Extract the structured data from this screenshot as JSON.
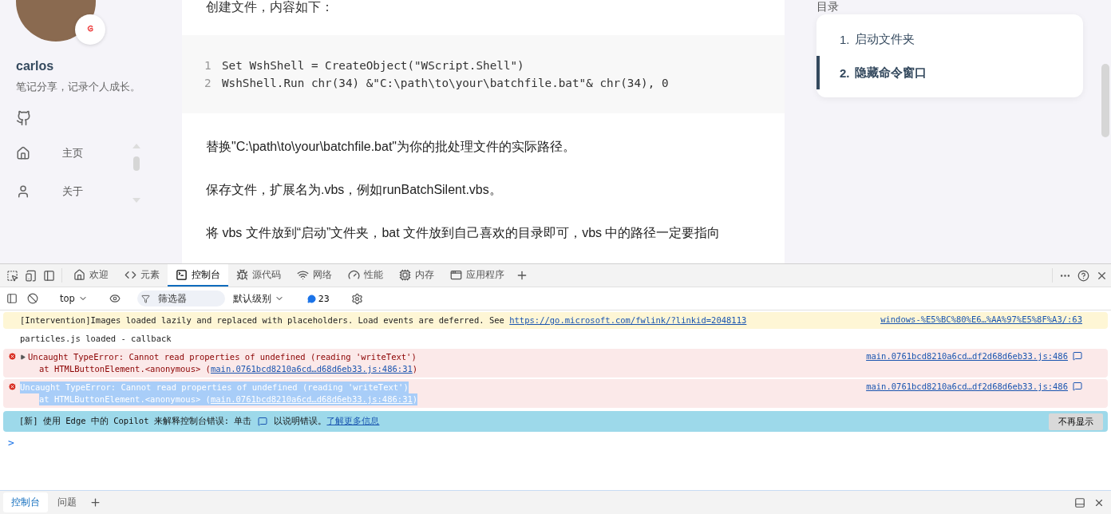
{
  "sidebar": {
    "name": "carlos",
    "bio": "笔记分享，记录个人成长。",
    "nav": [
      {
        "kind": "home",
        "label": "主页"
      },
      {
        "kind": "user",
        "label": "关于"
      }
    ]
  },
  "article": {
    "intro": "创建文件，内容如下：",
    "code": [
      {
        "number": "1",
        "text": "Set WshShell = CreateObject(\"WScript.Shell\")"
      },
      {
        "number": "2",
        "text": "WshShell.Run chr(34) &\"C:\\path\\to\\your\\batchfile.bat\"& chr(34), 0"
      }
    ],
    "paragraphs": [
      "替换\"C:\\path\\to\\your\\batchfile.bat\"为你的批处理文件的实际路径。",
      "保存文件，扩展名为.vbs，例如runBatchSilent.vbs。",
      "将 vbs 文件放到“启动”文件夹，bat 文件放到自己喜欢的目录即可，vbs 中的路径一定要指向"
    ]
  },
  "toc": {
    "title": "目录",
    "items": [
      {
        "number": "1.",
        "label": "启动文件夹",
        "selected": false
      },
      {
        "number": "2.",
        "label": "隐藏命令窗口",
        "selected": true
      }
    ]
  },
  "devtools": {
    "tabs": [
      {
        "kind": "home",
        "label": "欢迎",
        "selected": false
      },
      {
        "kind": "code",
        "label": "元素",
        "selected": false
      },
      {
        "kind": "console",
        "label": "控制台",
        "selected": true
      },
      {
        "kind": "bug",
        "label": "源代码",
        "selected": false
      },
      {
        "kind": "wifi",
        "label": "网络",
        "selected": false
      },
      {
        "kind": "gauge",
        "label": "性能",
        "selected": false
      },
      {
        "kind": "chip",
        "label": "内存",
        "selected": false
      },
      {
        "kind": "app",
        "label": "应用程序",
        "selected": false
      }
    ],
    "toolbar": {
      "context": "top",
      "filter_placeholder": "筛选器",
      "level": "默认级别",
      "message_count": "23"
    },
    "messages": [
      {
        "kind": "warning",
        "selected": false,
        "expander": false,
        "text": "[Intervention]Images loaded lazily and replaced with placeholders. Load events are deferred. See ",
        "link": "https://go.microsoft.com/fwlink/?linkid=2048113",
        "source": "windows-%E5%BC%80%E6…%AA%97%E5%8F%A3/:63"
      },
      {
        "kind": "log",
        "selected": false,
        "expander": false,
        "text": "particles.js loaded - callback"
      },
      {
        "kind": "error",
        "selected": false,
        "expander": true,
        "text": "Uncaught TypeError: Cannot read properties of undefined (reading 'writeText')",
        "stack_prefix": "at HTMLButtonElement.<anonymous> (",
        "stack_link": "main.0761bcd8210a6cd…d68d6eb33.js:486:31",
        "stack_suffix": ")",
        "source": "main.0761bcd8210a6cd…df2d68d6eb33.js:486"
      },
      {
        "kind": "error",
        "selected": true,
        "expander": false,
        "text": "Uncaught TypeError: Cannot read properties of undefined (reading 'writeText')",
        "stack_prefix": "at HTMLButtonElement.<anonymous> (",
        "stack_link": "main.0761bcd8210a6cd…d68d6eb33.js:486:31",
        "stack_suffix": ")",
        "source": "main.0761bcd8210a6cd…df2d68d6eb33.js:486"
      }
    ],
    "copilot": {
      "text_before": "[新] 使用 Edge 中的 Copilot 来解释控制台错误: 单击",
      "text_after": "以说明错误。",
      "link": "了解更多信息",
      "button": "不再显示"
    },
    "prompt": ">",
    "drawer_tabs": [
      {
        "label": "控制台",
        "selected": true
      },
      {
        "label": "问题",
        "selected": false
      }
    ]
  }
}
